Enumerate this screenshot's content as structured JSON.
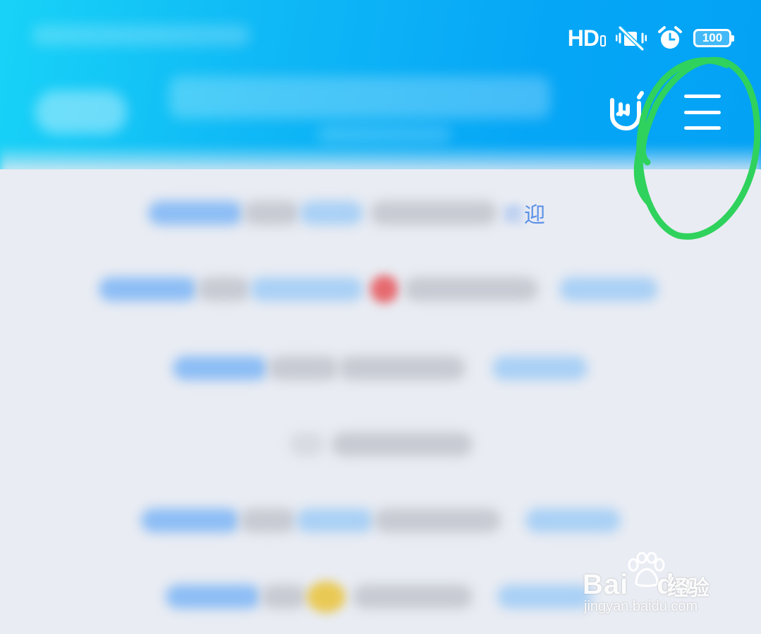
{
  "status_bar": {
    "network": "HD",
    "battery_level": "100",
    "icons": [
      "hd-signal-icon",
      "vibrate-mute-icon",
      "alarm-clock-icon",
      "battery-icon"
    ]
  },
  "header": {
    "background_color": "#03a2f5",
    "right_icons": [
      "rock-hand-icon",
      "menu-icon"
    ]
  },
  "list": {
    "rows": [
      {
        "visible_text": "迎"
      },
      {
        "visible_text": ""
      },
      {
        "visible_text": ""
      },
      {
        "visible_text": ""
      },
      {
        "visible_text": ""
      },
      {
        "visible_text": ""
      }
    ]
  },
  "annotation": {
    "color": "#2fd25c",
    "shape": "hand-drawn circle",
    "target": "menu-icon"
  },
  "watermark": {
    "brand": "Bai",
    "brand_tail": "du",
    "cn": "经验",
    "url": "jingyan.baidu.com"
  }
}
